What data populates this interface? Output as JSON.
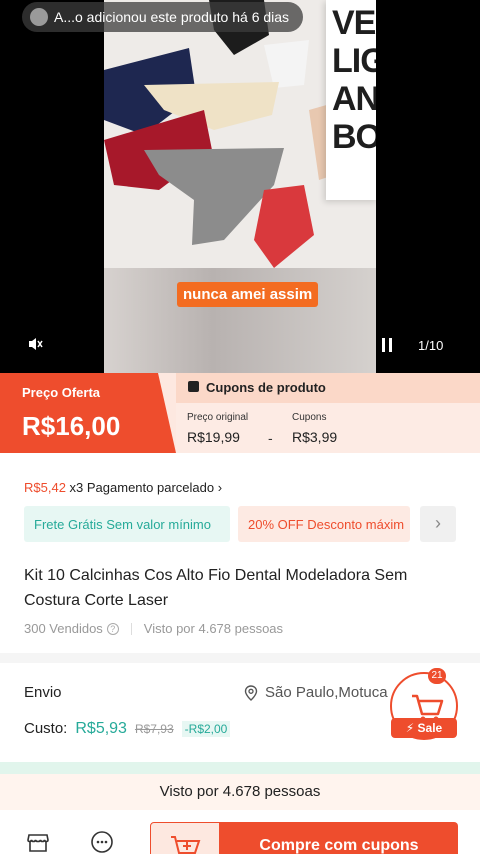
{
  "media": {
    "toast_text": "A...o adicionou este produto há 6 dias",
    "caption": "nunca amei assim",
    "counter": "1/10",
    "card_text": "VEX\nLIG\nAN\nBO"
  },
  "price": {
    "offer_label": "Preço Oferta",
    "offer_value": "R$16,00",
    "coupons_title": "Cupons de produto",
    "original_label": "Preço original",
    "original_value": "R$19,99",
    "coupons_label": "Cupons",
    "coupons_value": "R$3,99",
    "minus": "-"
  },
  "installment": {
    "amount": "R$5,42",
    "text": " x3 Pagamento parcelado ",
    "arrow": "›"
  },
  "chips": {
    "free_shipping": "Frete Grátis Sem valor mínimo",
    "discount": "20% OFF Desconto máxim",
    "more": "›"
  },
  "product": {
    "title": "Kit 10 Calcinhas Cos Alto Fio Dental Modeladora Sem Costura Corte Laser",
    "sold": "300 Vendidos",
    "help": "?",
    "seen": "Visto por 4.678 pessoas"
  },
  "shipping": {
    "label": "Envio",
    "location": "São Paulo,Motuca",
    "cost_label": "Custo:",
    "cost_now": "R$5,93",
    "cost_old": "R$7,93",
    "cost_discount": "-R$2,00"
  },
  "fab": {
    "badge": "21",
    "sale": "Sale"
  },
  "bottom": {
    "seen_bar": "Visto por 4.678 pessoas",
    "buy_label": "Compre com cupons"
  },
  "colors": {
    "brand": "#ee4d2d",
    "teal": "#26aa99"
  }
}
